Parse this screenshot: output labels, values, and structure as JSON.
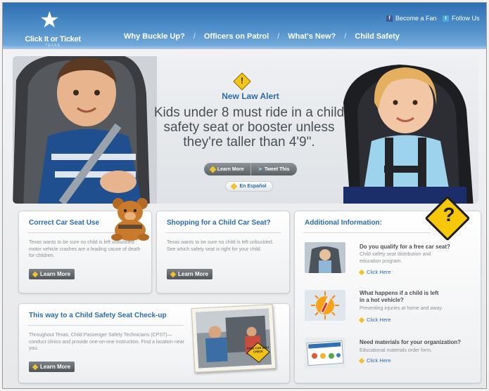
{
  "header": {
    "logo_text": "Click It or Ticket",
    "logo_sub": "TEXAS",
    "social": [
      {
        "label": "Become a Fan",
        "icon": "facebook-icon"
      },
      {
        "label": "Follow Us",
        "icon": "twitter-icon"
      }
    ],
    "nav": [
      "Why Buckle Up?",
      "Officers on Patrol",
      "What's New?",
      "Child Safety"
    ],
    "nav_sep": "/"
  },
  "hero": {
    "alert_title": "New Law Alert",
    "headline": "Kids under 8 must ride in a child safety seat or booster unless they're taller than 4'9\".",
    "learn_more": "Learn More",
    "tweet": "Tweet This",
    "espanol": "En Español"
  },
  "panels": {
    "correct_seat": {
      "title": "Correct Car Seat Use",
      "text": "Texas wants to be sure no child is left unbuckled : motor vehicle crashes are a leading cause of death for children.",
      "button": "Learn More"
    },
    "shopping": {
      "title": "Shopping for a Child Car Seat?",
      "text": "Texas wants to be sure no child is left unbuckled. See which safety seat is right for your child.",
      "button": "Learn More"
    },
    "checkup": {
      "title": "This way to a Child Safety Seat Check-up",
      "text": "Throughout Texas, Child Passenger Safety Technicians (CPST)— conduct clinics and provide one-on-one instruction. Find a location near you.",
      "button": "Learn More",
      "photo_sign": "FREE CAR SEAT CHECK"
    },
    "additional": {
      "title": "Additional Information:",
      "items": [
        {
          "title": "Do you qualify for a free car seat?",
          "desc": "Child safety seat distribution and education program.",
          "link": "Click Here"
        },
        {
          "title": "What happens if a child is left in a hot vehicle?",
          "desc": "Preventing injuries at home and away.",
          "link": "Click Here"
        },
        {
          "title": "Need materials for your organization?",
          "desc": "Educational materials order form.",
          "link": "Click Here"
        }
      ]
    }
  },
  "colors": {
    "header_blue": "#3d7fc0",
    "link_blue": "#2a6cb0",
    "accent_yellow": "#f5c518",
    "button_gray": "#5f6468"
  }
}
